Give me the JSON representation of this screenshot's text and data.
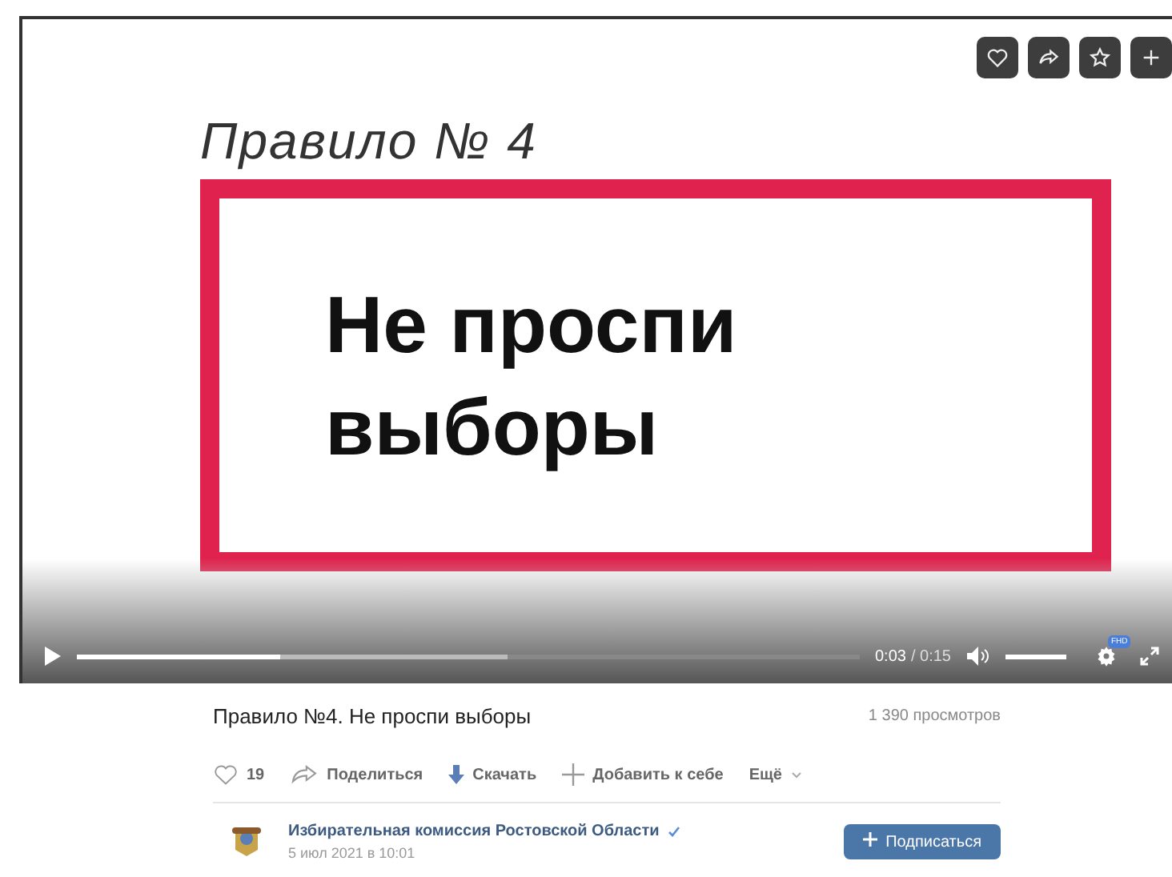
{
  "slide": {
    "heading": "Правило № 4",
    "message_lines": [
      "Не проспи",
      "выборы"
    ]
  },
  "overlay_buttons": [
    {
      "kind": "heart"
    },
    {
      "kind": "share"
    },
    {
      "kind": "star"
    },
    {
      "kind": "plus"
    }
  ],
  "player": {
    "played": {
      "level": 0.26
    },
    "buffered": {
      "level": 0.55
    },
    "time_current": "0:03",
    "time_total": "/ 0:15",
    "volume": {
      "level": 1
    },
    "quality_badge": "FHD"
  },
  "video_title": "Правило №4. Не проспи выборы",
  "views": "1 390 просмотров",
  "actions": [
    {
      "kind": "like",
      "label": "19"
    },
    {
      "kind": "share",
      "label": "Поделиться"
    },
    {
      "kind": "download",
      "label": "Скачать"
    },
    {
      "kind": "add",
      "label": "Добавить к себе"
    },
    {
      "kind": "more",
      "label": "Ещё"
    }
  ],
  "channel": {
    "name": "Избирательная комиссия Ростовской Области",
    "verified": true,
    "date": "5 июл 2021 в 10:01",
    "subscribe": "Подписаться"
  }
}
